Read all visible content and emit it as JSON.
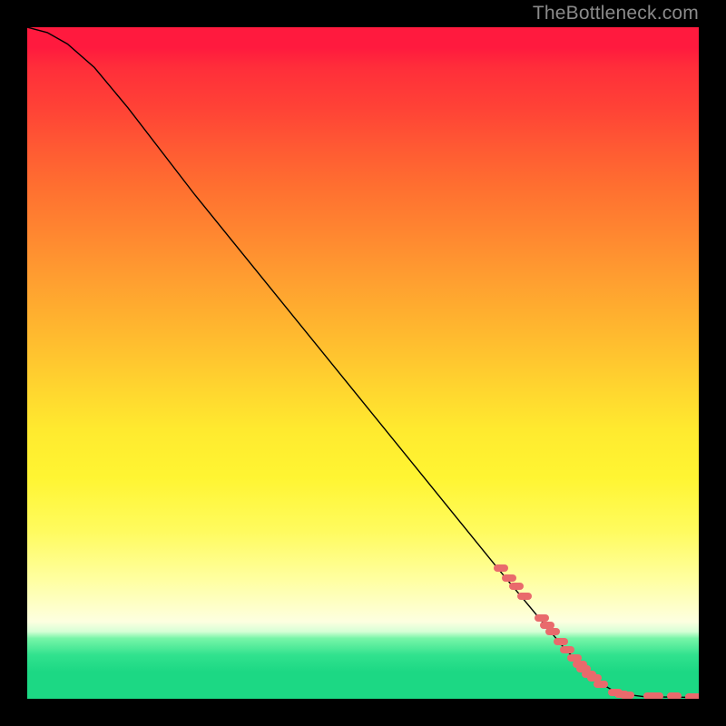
{
  "attribution": "TheBottleneck.com",
  "chart_data": {
    "type": "line",
    "title": "",
    "xlabel": "",
    "ylabel": "",
    "xlim": [
      0,
      100
    ],
    "ylim": [
      0,
      100
    ],
    "curve": [
      {
        "x": 0,
        "y": 100
      },
      {
        "x": 3,
        "y": 99.2
      },
      {
        "x": 6,
        "y": 97.5
      },
      {
        "x": 10,
        "y": 94.0
      },
      {
        "x": 15,
        "y": 88.0
      },
      {
        "x": 25,
        "y": 75.0
      },
      {
        "x": 40,
        "y": 56.5
      },
      {
        "x": 55,
        "y": 38.0
      },
      {
        "x": 70,
        "y": 19.5
      },
      {
        "x": 80,
        "y": 7.5
      },
      {
        "x": 85,
        "y": 2.5
      },
      {
        "x": 88,
        "y": 0.8
      },
      {
        "x": 92,
        "y": 0.3
      },
      {
        "x": 100,
        "y": 0.2
      }
    ],
    "points": [
      {
        "x": 70.5,
        "y": 19.5
      },
      {
        "x": 71.8,
        "y": 18.0
      },
      {
        "x": 72.9,
        "y": 16.8
      },
      {
        "x": 74.1,
        "y": 15.3
      },
      {
        "x": 76.6,
        "y": 12.0
      },
      {
        "x": 77.4,
        "y": 11.0
      },
      {
        "x": 78.2,
        "y": 10.0
      },
      {
        "x": 79.4,
        "y": 8.5
      },
      {
        "x": 80.4,
        "y": 7.3
      },
      {
        "x": 81.5,
        "y": 6.1
      },
      {
        "x": 82.3,
        "y": 5.1
      },
      {
        "x": 82.9,
        "y": 4.5
      },
      {
        "x": 83.7,
        "y": 3.7
      },
      {
        "x": 84.4,
        "y": 3.1
      },
      {
        "x": 85.4,
        "y": 2.2
      },
      {
        "x": 87.6,
        "y": 0.9
      },
      {
        "x": 88.5,
        "y": 0.7
      },
      {
        "x": 89.3,
        "y": 0.55
      },
      {
        "x": 92.8,
        "y": 0.4
      },
      {
        "x": 93.6,
        "y": 0.4
      },
      {
        "x": 96.3,
        "y": 0.35
      },
      {
        "x": 99.0,
        "y": 0.3
      },
      {
        "x": 99.8,
        "y": 0.3
      }
    ]
  }
}
